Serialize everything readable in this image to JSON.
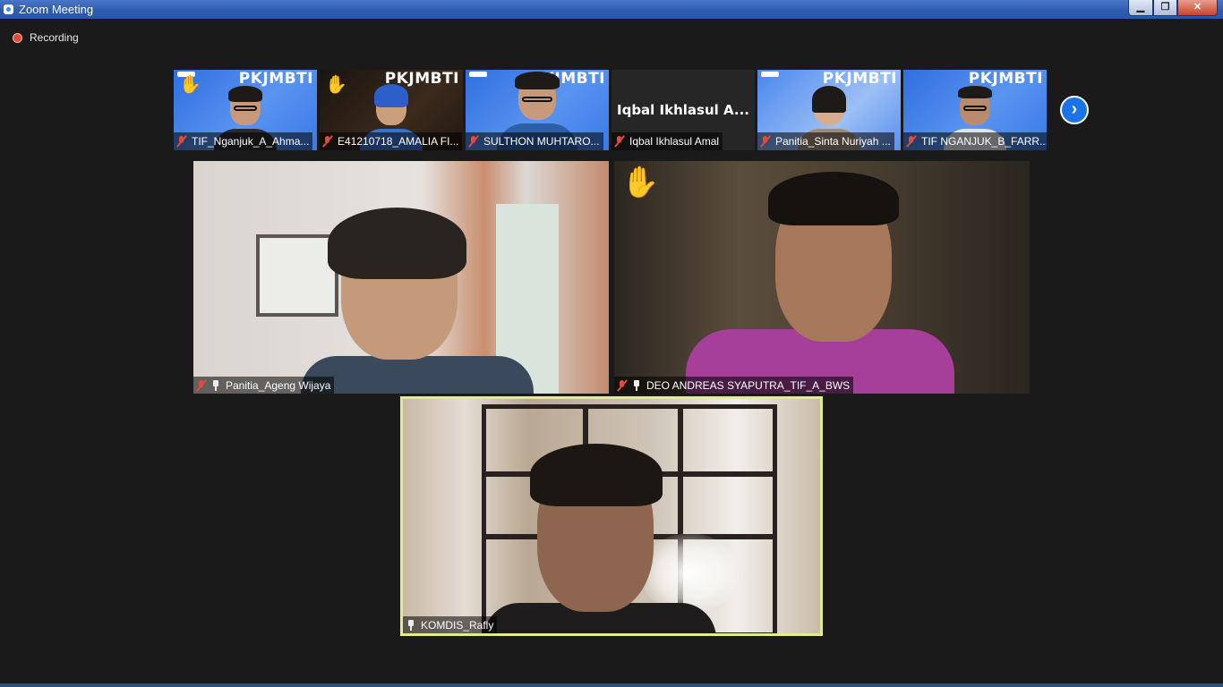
{
  "window": {
    "title": "Zoom Meeting",
    "minimize": "▁",
    "maximize": "❐",
    "close": "✕"
  },
  "recording": {
    "label": "Recording"
  },
  "gallery_strip": {
    "brand": "PKJMBTI",
    "thumbs": [
      {
        "name": "TIF_Nganjuk_A_Ahma...",
        "hand_raised": true,
        "muted": true
      },
      {
        "name": "E41210718_AMALIA FI...",
        "hand_raised": true,
        "muted": true
      },
      {
        "name": "SULTHON MUHTARO...",
        "hand_raised": false,
        "muted": true
      },
      {
        "name": "Iqbal Ikhlasul Amal",
        "display_name": "Iqbal Ikhlasul A...",
        "hand_raised": false,
        "muted": true
      },
      {
        "name": "Panitia_Sinta Nuriyah ...",
        "hand_raised": false,
        "muted": true
      },
      {
        "name": "TIF NGANJUK_B_FARR...",
        "hand_raised": false,
        "muted": true
      }
    ],
    "next_icon": "›"
  },
  "main_tiles": [
    {
      "name": "Panitia_Ageng Wijaya",
      "muted": true,
      "pinned": true
    },
    {
      "name": "DEO ANDREAS SYAPUTRA_TIF_A_BWS",
      "muted": true,
      "pinned": true,
      "hand_raised": true
    },
    {
      "name": "KOMDIS_Rafly",
      "muted": false,
      "pinned": true,
      "active_speaker": true
    }
  ],
  "icons": {
    "hand": "✋",
    "mic_muted": "mic-muted-icon",
    "pin": "pin-icon"
  }
}
